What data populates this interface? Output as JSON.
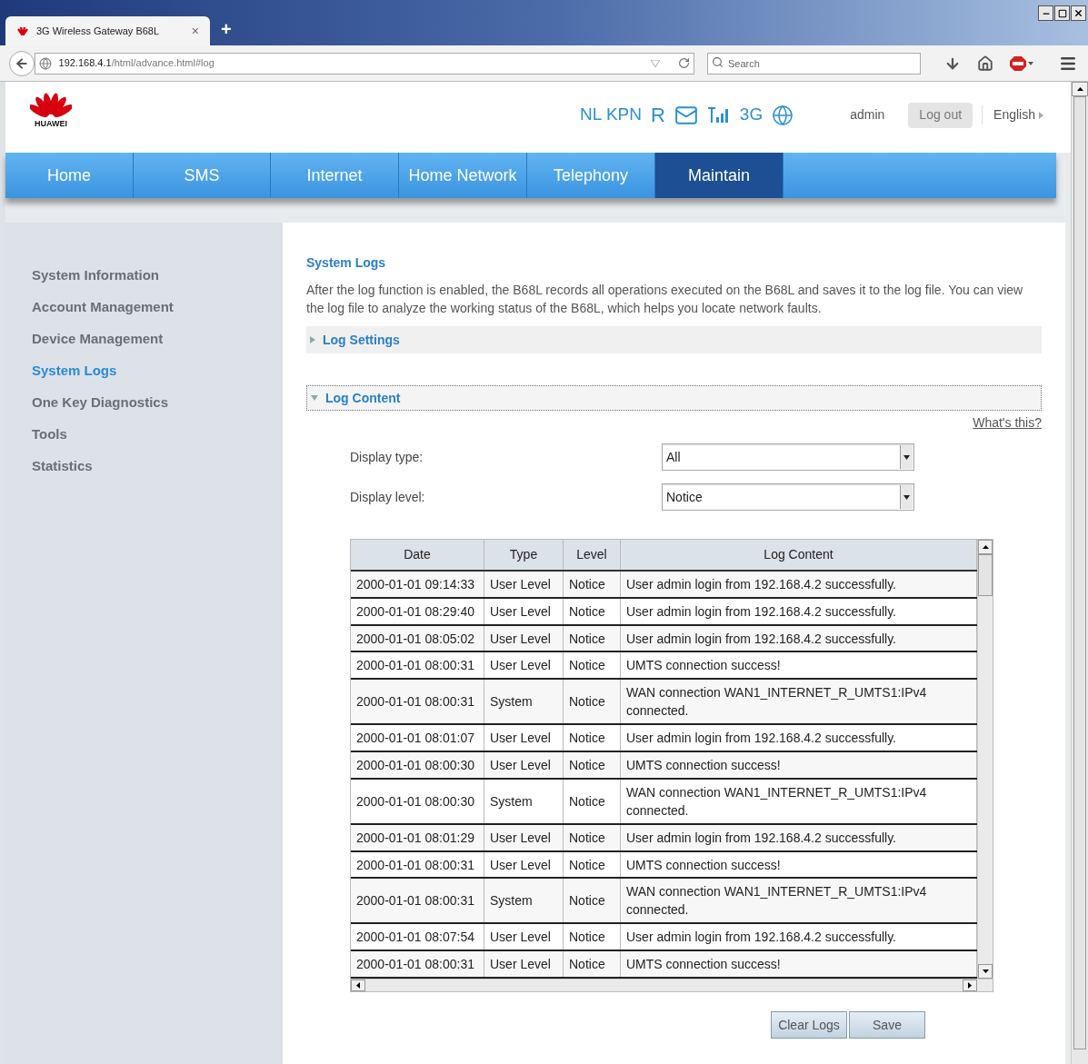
{
  "browser": {
    "tab_title": "3G Wireless Gateway B68L",
    "tab_close": "×",
    "new_tab": "+",
    "url_host": "192.168.4.1",
    "url_path": "/html/advance.html#log",
    "search_placeholder": "Search"
  },
  "header": {
    "logo_text": "HUAWEI",
    "operator": "NL KPN",
    "roaming": "R",
    "network": "3G",
    "user": "admin",
    "logout": "Log out",
    "language": "English"
  },
  "nav": [
    {
      "label": "Home",
      "selected": false
    },
    {
      "label": "SMS",
      "selected": false
    },
    {
      "label": "Internet",
      "selected": false
    },
    {
      "label": "Home Network",
      "selected": false
    },
    {
      "label": "Telephony",
      "selected": false
    },
    {
      "label": "Maintain",
      "selected": true
    }
  ],
  "sidebar": [
    {
      "label": "System Information",
      "selected": false
    },
    {
      "label": "Account Management",
      "selected": false
    },
    {
      "label": "Device Management",
      "selected": false
    },
    {
      "label": "System Logs",
      "selected": true
    },
    {
      "label": "One Key Diagnostics",
      "selected": false
    },
    {
      "label": "Tools",
      "selected": false
    },
    {
      "label": "Statistics",
      "selected": false
    }
  ],
  "content": {
    "title": "System Logs",
    "description": "After the log function is enabled, the B68L records all operations executed on the B68L and saves it to the log file. You can view the log file to analyze the working status of the B68L, which helps you locate network faults.",
    "sections": [
      {
        "label": "Log Settings",
        "expanded": false
      },
      {
        "label": "Log Content",
        "expanded": true
      }
    ],
    "whats_this": "What's this?",
    "filters": [
      {
        "label": "Display type:",
        "value": "All"
      },
      {
        "label": "Display level:",
        "value": "Notice"
      }
    ],
    "table": {
      "columns": [
        "Date",
        "Type",
        "Level",
        "Log Content"
      ],
      "rows": [
        [
          "2000-01-01 09:14:33",
          "User Level",
          "Notice",
          "User admin login from 192.168.4.2 successfully."
        ],
        [
          "2000-01-01 08:29:40",
          "User Level",
          "Notice",
          "User admin login from 192.168.4.2 successfully."
        ],
        [
          "2000-01-01 08:05:02",
          "User Level",
          "Notice",
          "User admin login from 192.168.4.2 successfully."
        ],
        [
          "2000-01-01 08:00:31",
          "User Level",
          "Notice",
          "UMTS connection success!"
        ],
        [
          "2000-01-01 08:00:31",
          "System",
          "Notice",
          "WAN connection WAN1_INTERNET_R_UMTS1:IPv4 connected."
        ],
        [
          "2000-01-01 08:01:07",
          "User Level",
          "Notice",
          "User admin login from 192.168.4.2 successfully."
        ],
        [
          "2000-01-01 08:00:30",
          "User Level",
          "Notice",
          "UMTS connection success!"
        ],
        [
          "2000-01-01 08:00:30",
          "System",
          "Notice",
          "WAN connection WAN1_INTERNET_R_UMTS1:IPv4 connected."
        ],
        [
          "2000-01-01 08:01:29",
          "User Level",
          "Notice",
          "User admin login from 192.168.4.2 successfully."
        ],
        [
          "2000-01-01 08:00:31",
          "User Level",
          "Notice",
          "UMTS connection success!"
        ],
        [
          "2000-01-01 08:00:31",
          "System",
          "Notice",
          "WAN connection WAN1_INTERNET_R_UMTS1:IPv4 connected."
        ],
        [
          "2000-01-01 08:07:54",
          "User Level",
          "Notice",
          "User admin login from 192.168.4.2 successfully."
        ],
        [
          "2000-01-01 08:00:31",
          "User Level",
          "Notice",
          "UMTS connection success!"
        ]
      ]
    },
    "buttons": [
      "Clear Logs",
      "Save"
    ]
  }
}
